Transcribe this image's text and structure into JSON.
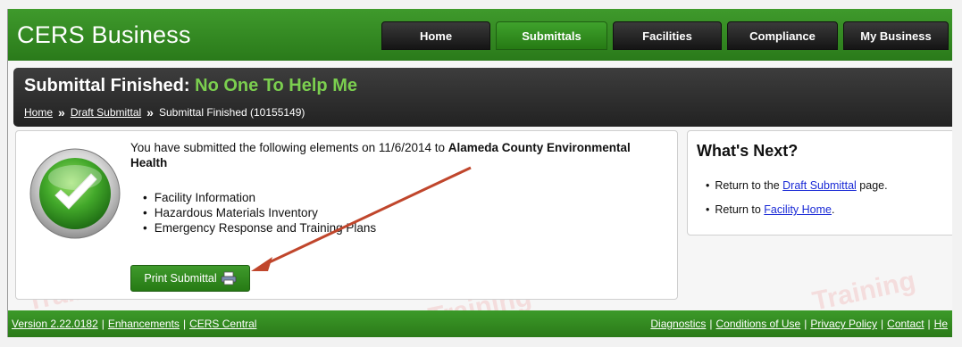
{
  "header": {
    "logo": "CERS Business",
    "nav": [
      {
        "label": "Home",
        "active": false
      },
      {
        "label": "Submittals",
        "active": true
      },
      {
        "label": "Facilities",
        "active": false
      },
      {
        "label": "Compliance",
        "active": false
      },
      {
        "label": "My Business",
        "active": false
      }
    ]
  },
  "title": {
    "prefix": "Submittal Finished: ",
    "name": "No One To Help Me"
  },
  "breadcrumb": {
    "home": "Home",
    "draft": "Draft Submittal",
    "current": "Submittal Finished (10155149)",
    "separator": "»"
  },
  "main": {
    "message_prefix": "You have submitted the following elements on 11/6/2014 to ",
    "agency": "Alameda County Environmental Health",
    "elements": [
      "Facility Information",
      "Hazardous Materials Inventory",
      "Emergency Response and Training Plans"
    ],
    "print_button": "Print Submittal"
  },
  "whats_next": {
    "heading": "What's Next?",
    "item1_prefix": "Return to the ",
    "item1_link": "Draft Submittal",
    "item1_suffix": " page.",
    "item2_prefix": "Return to ",
    "item2_link": "Facility Home",
    "item2_suffix": "."
  },
  "footer": {
    "version": "Version 2.22.0182",
    "enhancements": "Enhancements",
    "cers_central": "CERS Central",
    "diagnostics": "Diagnostics",
    "conditions": "Conditions of Use",
    "privacy": "Privacy Policy",
    "contact": "Contact",
    "help": "He"
  },
  "watermark_text": "Training",
  "colors": {
    "brand_green": "#2f8a1f",
    "accent_green": "#7bcf4f",
    "dark_bar": "#2a2a2a",
    "arrow": "#c0462c",
    "link_blue": "#1a2ad6"
  }
}
